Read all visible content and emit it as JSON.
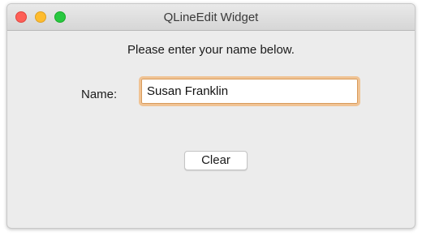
{
  "window": {
    "title": "QLineEdit Widget"
  },
  "main": {
    "prompt": "Please enter your name below.",
    "name_label": "Name:",
    "name_value": "Susan Franklin",
    "clear_label": "Clear"
  },
  "colors": {
    "window_bg": "#ececec",
    "focus_ring": "#f0c394",
    "close": "#fe5f57",
    "minimize": "#febc2e",
    "maximize": "#28c840"
  }
}
